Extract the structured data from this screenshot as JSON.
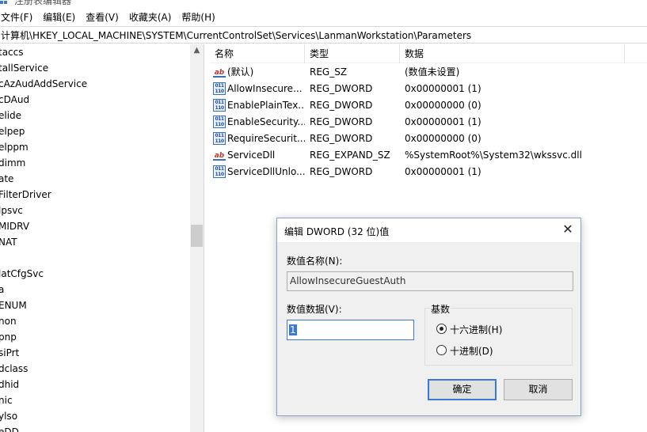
{
  "window": {
    "title": "注册表编辑器"
  },
  "menu": [
    "文件(F)",
    "编辑(E)",
    "查看(V)",
    "收藏夹(A)",
    "帮助(H)"
  ],
  "address": "计算机\\HKEY_LOCAL_MACHINE\\SYSTEM\\CurrentControlSet\\Services\\LanmanWorkstation\\Parameters",
  "tree": {
    "items": [
      "taccs",
      "tallService",
      "cAzAudAddService",
      "cDAud",
      "elide",
      "elpep",
      "elppm",
      "dimm",
      "ate",
      "FilterDriver",
      "lpsvc",
      "MIDRV",
      "NAT",
      "",
      "latCfgSvc",
      "a",
      "ENUM",
      "non",
      "pnp",
      "siPrt",
      "dclass",
      "dhid",
      "nic",
      "ylso",
      "eDD"
    ]
  },
  "list": {
    "columns": [
      "名称",
      "类型",
      "数据"
    ],
    "rows": [
      {
        "icon": "string-value-icon",
        "name": "(默认)",
        "type": "REG_SZ",
        "data": "(数值未设置)"
      },
      {
        "icon": "dword-value-icon",
        "name": "AllowInsecure...",
        "type": "REG_DWORD",
        "data": "0x00000001 (1)"
      },
      {
        "icon": "dword-value-icon",
        "name": "EnablePlainTex...",
        "type": "REG_DWORD",
        "data": "0x00000000 (0)"
      },
      {
        "icon": "dword-value-icon",
        "name": "EnableSecurity...",
        "type": "REG_DWORD",
        "data": "0x00000001 (1)"
      },
      {
        "icon": "dword-value-icon",
        "name": "RequireSecurit...",
        "type": "REG_DWORD",
        "data": "0x00000000 (0)"
      },
      {
        "icon": "string-value-icon",
        "name": "ServiceDll",
        "type": "REG_EXPAND_SZ",
        "data": "%SystemRoot%\\System32\\wkssvc.dll"
      },
      {
        "icon": "dword-value-icon",
        "name": "ServiceDllUnlo...",
        "type": "REG_DWORD",
        "data": "0x00000001 (1)"
      }
    ]
  },
  "dialog": {
    "title": "编辑 DWORD (32 位)值",
    "name_label": "数值名称(N):",
    "name_value": "AllowInsecureGuestAuth",
    "data_label": "数值数据(V):",
    "data_value": "1",
    "base_label": "基数",
    "radio_hex": "十六进制(H)",
    "radio_dec": "十进制(D)",
    "base_selected": "hex",
    "ok": "确定",
    "cancel": "取消"
  }
}
